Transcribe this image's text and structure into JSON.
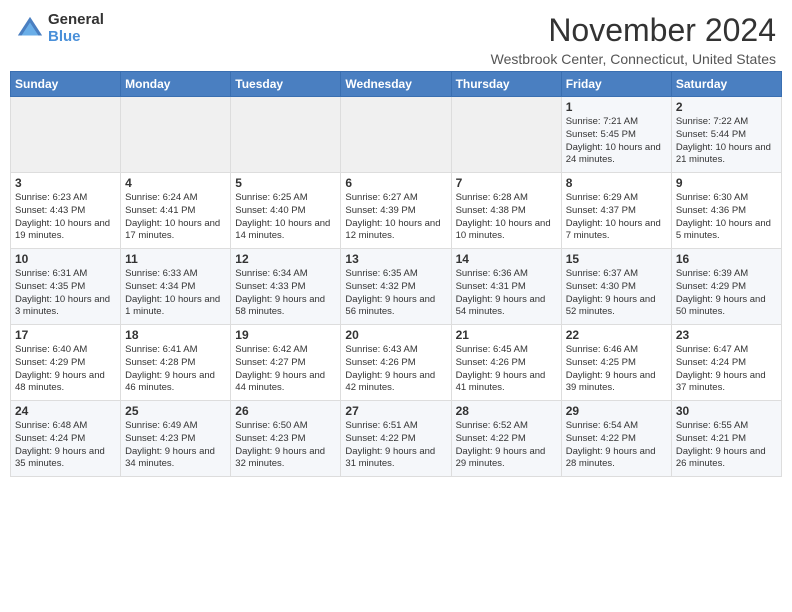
{
  "logo": {
    "general": "General",
    "blue": "Blue"
  },
  "header": {
    "title": "November 2024",
    "location": "Westbrook Center, Connecticut, United States"
  },
  "days_of_week": [
    "Sunday",
    "Monday",
    "Tuesday",
    "Wednesday",
    "Thursday",
    "Friday",
    "Saturday"
  ],
  "weeks": [
    [
      {
        "day": "",
        "info": ""
      },
      {
        "day": "",
        "info": ""
      },
      {
        "day": "",
        "info": ""
      },
      {
        "day": "",
        "info": ""
      },
      {
        "day": "",
        "info": ""
      },
      {
        "day": "1",
        "info": "Sunrise: 7:21 AM\nSunset: 5:45 PM\nDaylight: 10 hours and 24 minutes."
      },
      {
        "day": "2",
        "info": "Sunrise: 7:22 AM\nSunset: 5:44 PM\nDaylight: 10 hours and 21 minutes."
      }
    ],
    [
      {
        "day": "3",
        "info": "Sunrise: 6:23 AM\nSunset: 4:43 PM\nDaylight: 10 hours and 19 minutes."
      },
      {
        "day": "4",
        "info": "Sunrise: 6:24 AM\nSunset: 4:41 PM\nDaylight: 10 hours and 17 minutes."
      },
      {
        "day": "5",
        "info": "Sunrise: 6:25 AM\nSunset: 4:40 PM\nDaylight: 10 hours and 14 minutes."
      },
      {
        "day": "6",
        "info": "Sunrise: 6:27 AM\nSunset: 4:39 PM\nDaylight: 10 hours and 12 minutes."
      },
      {
        "day": "7",
        "info": "Sunrise: 6:28 AM\nSunset: 4:38 PM\nDaylight: 10 hours and 10 minutes."
      },
      {
        "day": "8",
        "info": "Sunrise: 6:29 AM\nSunset: 4:37 PM\nDaylight: 10 hours and 7 minutes."
      },
      {
        "day": "9",
        "info": "Sunrise: 6:30 AM\nSunset: 4:36 PM\nDaylight: 10 hours and 5 minutes."
      }
    ],
    [
      {
        "day": "10",
        "info": "Sunrise: 6:31 AM\nSunset: 4:35 PM\nDaylight: 10 hours and 3 minutes."
      },
      {
        "day": "11",
        "info": "Sunrise: 6:33 AM\nSunset: 4:34 PM\nDaylight: 10 hours and 1 minute."
      },
      {
        "day": "12",
        "info": "Sunrise: 6:34 AM\nSunset: 4:33 PM\nDaylight: 9 hours and 58 minutes."
      },
      {
        "day": "13",
        "info": "Sunrise: 6:35 AM\nSunset: 4:32 PM\nDaylight: 9 hours and 56 minutes."
      },
      {
        "day": "14",
        "info": "Sunrise: 6:36 AM\nSunset: 4:31 PM\nDaylight: 9 hours and 54 minutes."
      },
      {
        "day": "15",
        "info": "Sunrise: 6:37 AM\nSunset: 4:30 PM\nDaylight: 9 hours and 52 minutes."
      },
      {
        "day": "16",
        "info": "Sunrise: 6:39 AM\nSunset: 4:29 PM\nDaylight: 9 hours and 50 minutes."
      }
    ],
    [
      {
        "day": "17",
        "info": "Sunrise: 6:40 AM\nSunset: 4:29 PM\nDaylight: 9 hours and 48 minutes."
      },
      {
        "day": "18",
        "info": "Sunrise: 6:41 AM\nSunset: 4:28 PM\nDaylight: 9 hours and 46 minutes."
      },
      {
        "day": "19",
        "info": "Sunrise: 6:42 AM\nSunset: 4:27 PM\nDaylight: 9 hours and 44 minutes."
      },
      {
        "day": "20",
        "info": "Sunrise: 6:43 AM\nSunset: 4:26 PM\nDaylight: 9 hours and 42 minutes."
      },
      {
        "day": "21",
        "info": "Sunrise: 6:45 AM\nSunset: 4:26 PM\nDaylight: 9 hours and 41 minutes."
      },
      {
        "day": "22",
        "info": "Sunrise: 6:46 AM\nSunset: 4:25 PM\nDaylight: 9 hours and 39 minutes."
      },
      {
        "day": "23",
        "info": "Sunrise: 6:47 AM\nSunset: 4:24 PM\nDaylight: 9 hours and 37 minutes."
      }
    ],
    [
      {
        "day": "24",
        "info": "Sunrise: 6:48 AM\nSunset: 4:24 PM\nDaylight: 9 hours and 35 minutes."
      },
      {
        "day": "25",
        "info": "Sunrise: 6:49 AM\nSunset: 4:23 PM\nDaylight: 9 hours and 34 minutes."
      },
      {
        "day": "26",
        "info": "Sunrise: 6:50 AM\nSunset: 4:23 PM\nDaylight: 9 hours and 32 minutes."
      },
      {
        "day": "27",
        "info": "Sunrise: 6:51 AM\nSunset: 4:22 PM\nDaylight: 9 hours and 31 minutes."
      },
      {
        "day": "28",
        "info": "Sunrise: 6:52 AM\nSunset: 4:22 PM\nDaylight: 9 hours and 29 minutes."
      },
      {
        "day": "29",
        "info": "Sunrise: 6:54 AM\nSunset: 4:22 PM\nDaylight: 9 hours and 28 minutes."
      },
      {
        "day": "30",
        "info": "Sunrise: 6:55 AM\nSunset: 4:21 PM\nDaylight: 9 hours and 26 minutes."
      }
    ]
  ]
}
